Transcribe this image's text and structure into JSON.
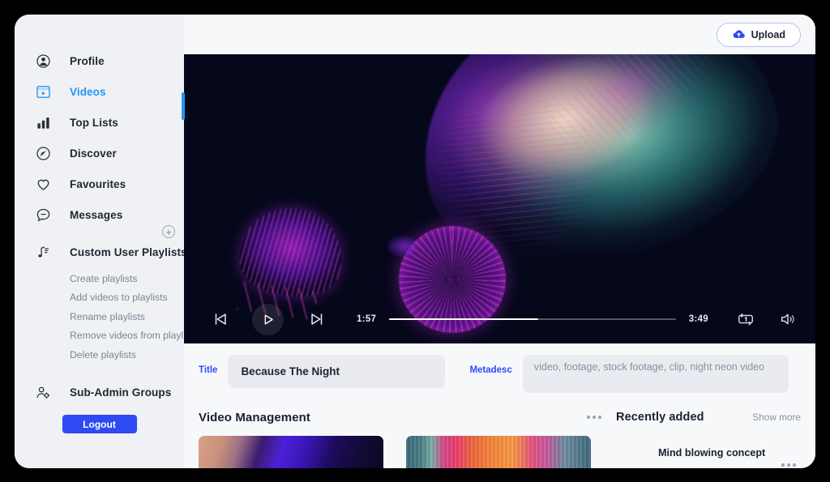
{
  "sidebar": {
    "nav": [
      {
        "label": "Profile",
        "icon": "profile-icon",
        "active": false
      },
      {
        "label": "Videos",
        "icon": "video-icon",
        "active": true
      },
      {
        "label": "Top Lists",
        "icon": "bar-chart-icon",
        "active": false
      },
      {
        "label": "Discover",
        "icon": "compass-icon",
        "active": false
      },
      {
        "label": "Favourites",
        "icon": "heart-icon",
        "active": false
      },
      {
        "label": "Messages",
        "icon": "chat-bubble-icon",
        "active": false
      }
    ],
    "playlists": {
      "label": "Custom User Playlists",
      "icon": "music-note-icon",
      "add_icon": "plus-circle-icon",
      "items": [
        "Create playlists",
        "Add videos to playlists",
        "Rename playlists",
        "Remove videos from playlists",
        "Delete playlists"
      ]
    },
    "sub_admin": {
      "label": "Sub-Admin Groups",
      "icon": "user-gear-icon"
    },
    "logout_label": "Logout"
  },
  "topbar": {
    "upload_label": "Upload",
    "upload_icon": "cloud-upload-icon"
  },
  "player": {
    "current_time": "1:57",
    "duration": "3:49",
    "progress_percent": 52,
    "prev_icon": "skip-previous-icon",
    "play_icon": "play-icon",
    "next_icon": "skip-next-icon",
    "repeat_icon": "repeat-one-icon",
    "volume_icon": "volume-icon"
  },
  "form": {
    "title_label": "Title",
    "title_value": "Because The Night",
    "title_placeholder": "Title",
    "metadesc_label": "Metadesc",
    "metadesc_value": "video, footage, stock footage, clip, night neon video",
    "metadesc_placeholder": "Metadesc"
  },
  "video_management": {
    "title": "Video Management",
    "menu_icon": "more-options-icon",
    "thumbnails": [
      {
        "name": "thumbnail-1"
      },
      {
        "name": "thumbnail-2"
      }
    ]
  },
  "recently_added": {
    "title": "Recently added",
    "show_more_label": "Show more",
    "items": [
      {
        "title": "Mind blowing concept",
        "menu_icon": "more-options-icon"
      }
    ]
  },
  "colors": {
    "accent_blue": "#2196f3",
    "brand_blue": "#2f4af5",
    "sidebar_bg": "#f0f1f5",
    "main_bg": "#f7f8fa",
    "video_bg": "#05071a",
    "field_bg": "#e9ebf1",
    "muted_text": "#8b92a4"
  }
}
